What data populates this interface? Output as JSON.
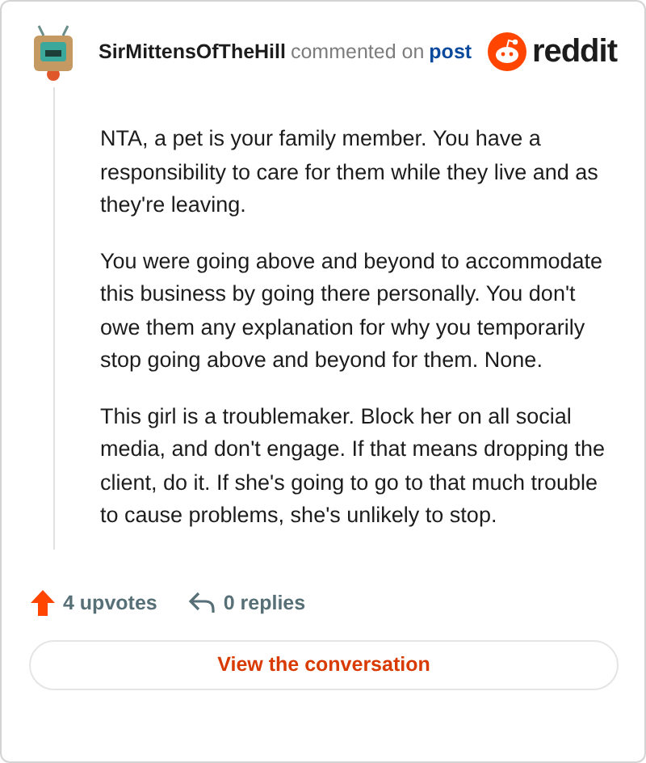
{
  "header": {
    "username": "SirMittensOfTheHill",
    "action": "commented on",
    "link": "post",
    "brand": "reddit"
  },
  "comment": {
    "paragraphs": [
      "NTA, a pet is your family member. You have a responsibility to care for them while they live and as they're leaving.",
      "You were going above and beyond to accommodate this business by going there personally. You don't owe them any explanation for why you temporarily stop going above and beyond for them. None.",
      "This girl is a troublemaker. Block her on all social media, and don't engage. If that means dropping the client, do it. If she's going to go to that much trouble to cause problems, she's unlikely to stop."
    ]
  },
  "stats": {
    "upvotes": "4 upvotes",
    "replies": "0 replies"
  },
  "button": "View the conversation"
}
